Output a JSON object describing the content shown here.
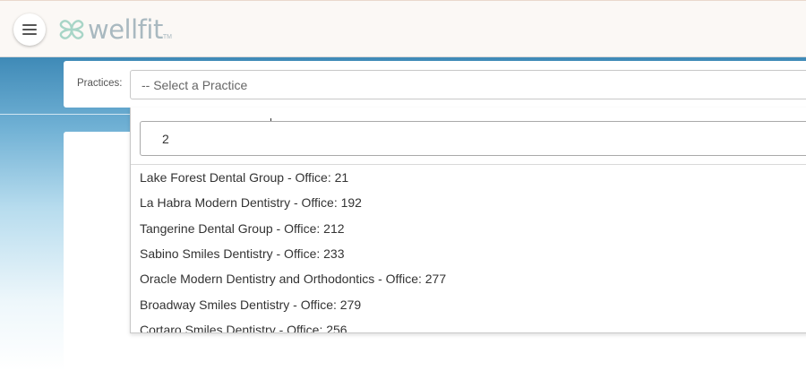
{
  "header": {
    "menu_icon": "hamburger-icon",
    "logo_icon": "wellfit-logo-icon",
    "logo_text": "wellfit",
    "logo_tm": "TM"
  },
  "practice_selector": {
    "label": "Practices:",
    "placeholder": "-- Select a Practice",
    "search_value": "2",
    "options": [
      "Lake Forest Dental Group - Office: 21",
      "La Habra Modern Dentistry - Office: 192",
      "Tangerine Dental Group - Office: 212",
      "Sabino Smiles Dentistry - Office: 233",
      "Oracle Modern Dentistry and Orthodontics - Office: 277",
      "Broadway Smiles Dentistry - Office: 279",
      "Cortaro Smiles Dentistry - Office: 256"
    ]
  },
  "colors": {
    "header_bg": "#fbf8f5",
    "hero_blue": "#3f8ab7",
    "logo_color": "#a9b9c0"
  }
}
